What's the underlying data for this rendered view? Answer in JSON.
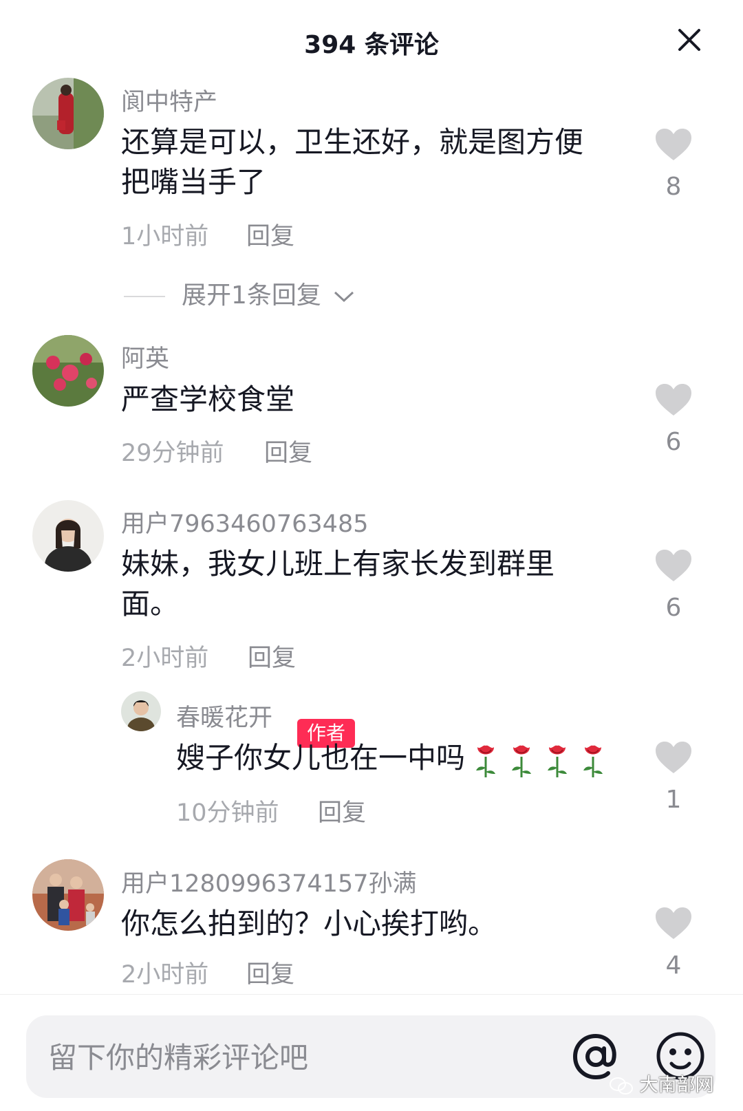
{
  "header": {
    "title": "394 条评论"
  },
  "comments": [
    {
      "name": "阆中特产",
      "text_lines": [
        "还算是可以，卫生还好，就是图方便",
        "把嘴当手了"
      ],
      "time": "1小时前",
      "reply": "回复",
      "likes": "8",
      "expand": "展开1条回复"
    },
    {
      "name": "阿英",
      "text_lines": [
        "严查学校食堂"
      ],
      "time": "29分钟前",
      "reply": "回复",
      "likes": "6"
    },
    {
      "name": "用户7963460763485",
      "text_lines": [
        "妹妹，我女儿班上有家长发到群里",
        "面。"
      ],
      "time": "2小时前",
      "reply": "回复",
      "likes": "6",
      "sub_reply": {
        "name": "春暖花开",
        "badge": "作者",
        "text": "嫂子你女儿也在一中吗",
        "emoji_icon": "rose-emoji",
        "emoji_count": 4,
        "time": "10分钟前",
        "reply": "回复",
        "likes": "1"
      }
    },
    {
      "name": "用户1280996374157孙满",
      "text_lines": [
        "你怎么拍到的？小心挨打哟。"
      ],
      "time": "2小时前",
      "reply": "回复",
      "likes": "4"
    }
  ],
  "input": {
    "placeholder": "留下你的精彩评论吧"
  },
  "icons": {
    "close": "close-icon",
    "like": "heart-icon",
    "at": "at-icon",
    "emoji": "smiley-icon",
    "wechat": "wechat-icon"
  },
  "watermark": "大南部网",
  "colors": {
    "badge": "#fe2c55",
    "heart": "#d0d0d2"
  }
}
